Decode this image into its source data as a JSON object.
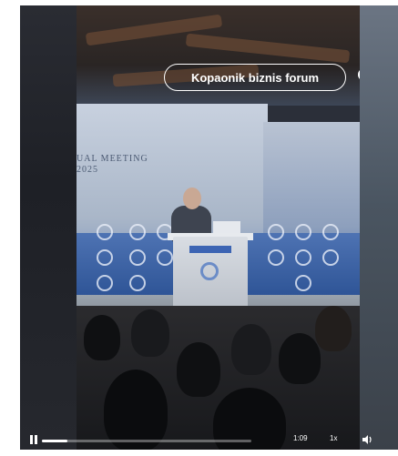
{
  "search": {
    "query": "Kopaonik biznis forum"
  },
  "icons": {
    "search": "search-icon",
    "play_pause": "pause-icon",
    "volume": "volume-icon"
  },
  "screen": {
    "line1": "UAL MEETING",
    "line2": "2025"
  },
  "player": {
    "time": "1:09",
    "speed": "1x",
    "progress": 0.12
  },
  "colors": {
    "accent": "#ffffff",
    "stage_blue": "#3d66ad"
  }
}
